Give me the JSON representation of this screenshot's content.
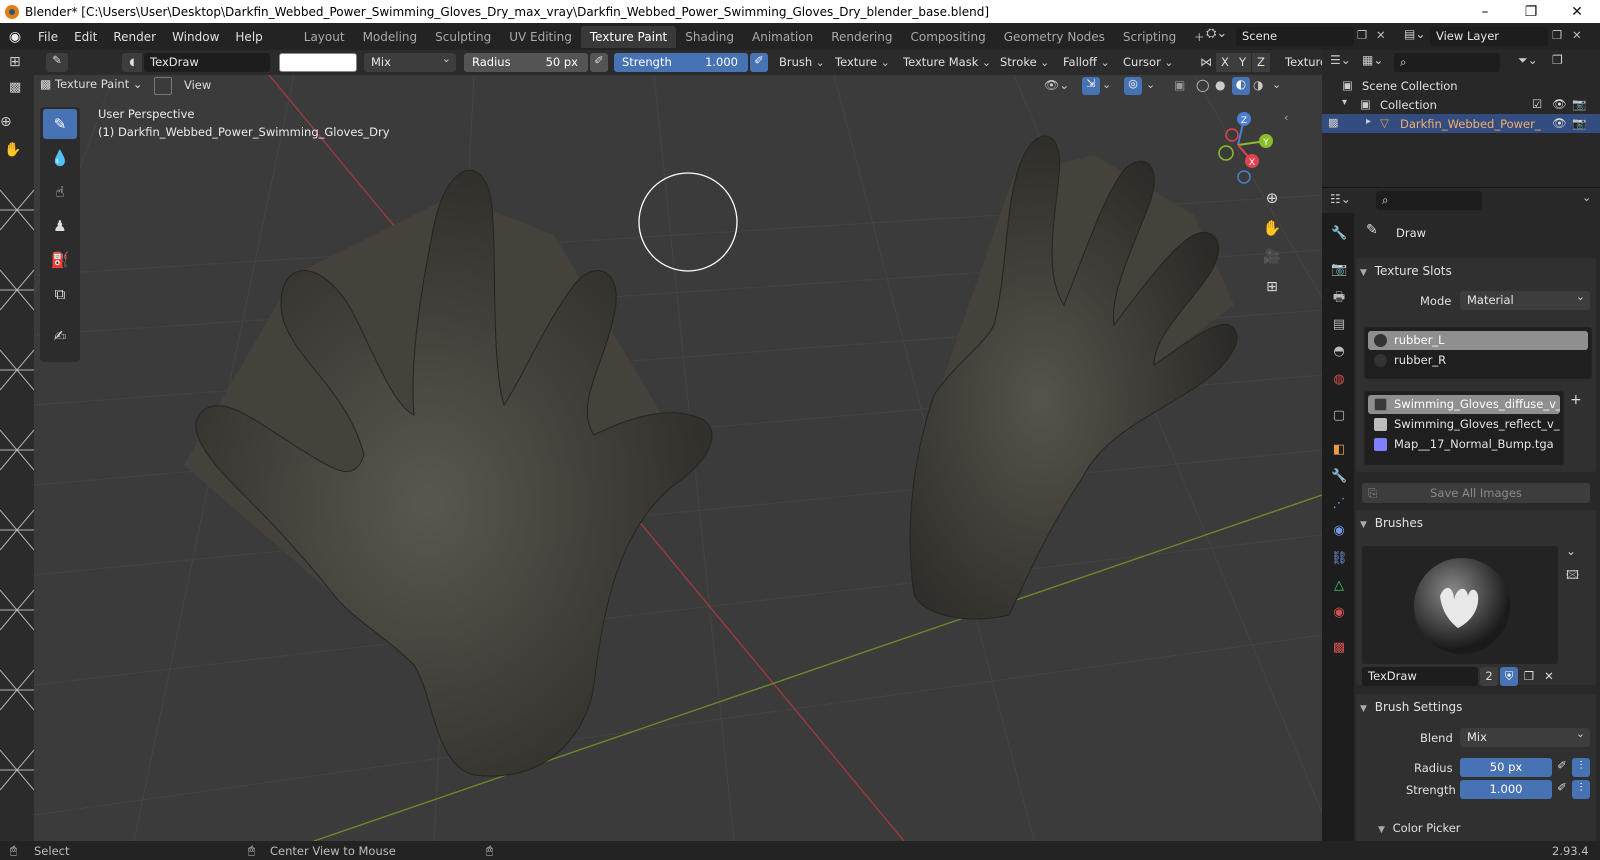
{
  "window": {
    "title": "Blender* [C:\\Users\\User\\Desktop\\Darkfin_Webbed_Power_Swimming_Gloves_Dry_max_vray\\Darkfin_Webbed_Power_Swimming_Gloves_Dry_blender_base.blend]",
    "minimize": "–",
    "maximize": "❐",
    "close": "✕"
  },
  "menubar": {
    "menus": [
      "File",
      "Edit",
      "Render",
      "Window",
      "Help"
    ],
    "workspaces": [
      "Layout",
      "Modeling",
      "Sculpting",
      "UV Editing",
      "Texture Paint",
      "Shading",
      "Animation",
      "Rendering",
      "Compositing",
      "Geometry Nodes",
      "Scripting"
    ],
    "active_workspace": "Texture Paint",
    "add_tab": "+",
    "scene": "Scene",
    "view_layer": "View Layer"
  },
  "toolheader": {
    "brush_name": "TexDraw",
    "blend": "Mix",
    "radius_label": "Radius",
    "radius_value": "50 px",
    "strength_label": "Strength",
    "strength_value": "1.000",
    "menus": [
      "Brush",
      "Texture",
      "Texture Mask",
      "Stroke",
      "Falloff",
      "Cursor"
    ],
    "axes": [
      "X",
      "Y",
      "Z"
    ],
    "texture_label": "Texture"
  },
  "viewport_header": {
    "mode": "Texture Paint",
    "view": "View"
  },
  "viewport": {
    "perspective": "User Perspective",
    "object_info": "(1) Darkfin_Webbed_Power_Swimming_Gloves_Dry",
    "gizmo_axes": [
      "Z",
      "Y",
      "X"
    ],
    "colors": {
      "background": "#3b3b3b",
      "grid_red": "#a4343a",
      "grid_green": "#6c8a2c",
      "glove": "#4a4740"
    }
  },
  "outliner": {
    "scene_collection": "Scene Collection",
    "collection": "Collection",
    "object": "Darkfin_Webbed_Power_"
  },
  "properties": {
    "active_tool": "Draw",
    "texture_slots": {
      "title": "Texture Slots",
      "mode_label": "Mode",
      "mode_value": "Material",
      "materials": [
        "rubber_L",
        "rubber_R"
      ],
      "images": [
        {
          "name": "Swimming_Gloves_diffuse_v_a...",
          "color": "#3a3a3a"
        },
        {
          "name": "Swimming_Gloves_reflect_v_a...",
          "color": "#bdbdbd"
        },
        {
          "name": "Map__17_Normal_Bump.tga",
          "color": "#8080ff"
        }
      ],
      "save_all": "Save All Images"
    },
    "brushes": {
      "title": "Brushes",
      "brush_name": "TexDraw",
      "users": "2"
    },
    "brush_settings": {
      "title": "Brush Settings",
      "blend_label": "Blend",
      "blend_value": "Mix",
      "radius_label": "Radius",
      "radius_value": "50 px",
      "strength_label": "Strength",
      "strength_value": "1.000"
    },
    "color_picker": "Color Picker"
  },
  "statusbar": {
    "select": "Select",
    "center_view": "Center View to Mouse",
    "version": "2.93.4"
  }
}
